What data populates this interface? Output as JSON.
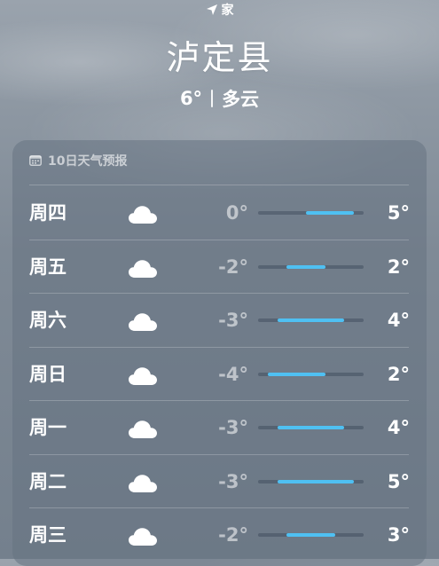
{
  "header": {
    "location_label": "家",
    "location_icon": "location-arrow-icon",
    "city": "泸定县",
    "current_temp": "6°",
    "condition": "多云"
  },
  "forecast": {
    "title": "10日天气预报",
    "title_icon": "calendar-icon",
    "range_min": -5,
    "range_max": 6,
    "accent_color": "#4fc0f2",
    "days": [
      {
        "day": "周四",
        "icon": "cloud-icon",
        "low": "0°",
        "high": "5°",
        "low_value": 0,
        "high_value": 5
      },
      {
        "day": "周五",
        "icon": "cloud-icon",
        "low": "-2°",
        "high": "2°",
        "low_value": -2,
        "high_value": 2
      },
      {
        "day": "周六",
        "icon": "cloud-icon",
        "low": "-3°",
        "high": "4°",
        "low_value": -3,
        "high_value": 4
      },
      {
        "day": "周日",
        "icon": "cloud-icon",
        "low": "-4°",
        "high": "2°",
        "low_value": -4,
        "high_value": 2
      },
      {
        "day": "周一",
        "icon": "cloud-icon",
        "low": "-3°",
        "high": "4°",
        "low_value": -3,
        "high_value": 4
      },
      {
        "day": "周二",
        "icon": "cloud-icon",
        "low": "-3°",
        "high": "5°",
        "low_value": -3,
        "high_value": 5
      },
      {
        "day": "周三",
        "icon": "cloud-icon",
        "low": "-2°",
        "high": "3°",
        "low_value": -2,
        "high_value": 3
      }
    ]
  }
}
